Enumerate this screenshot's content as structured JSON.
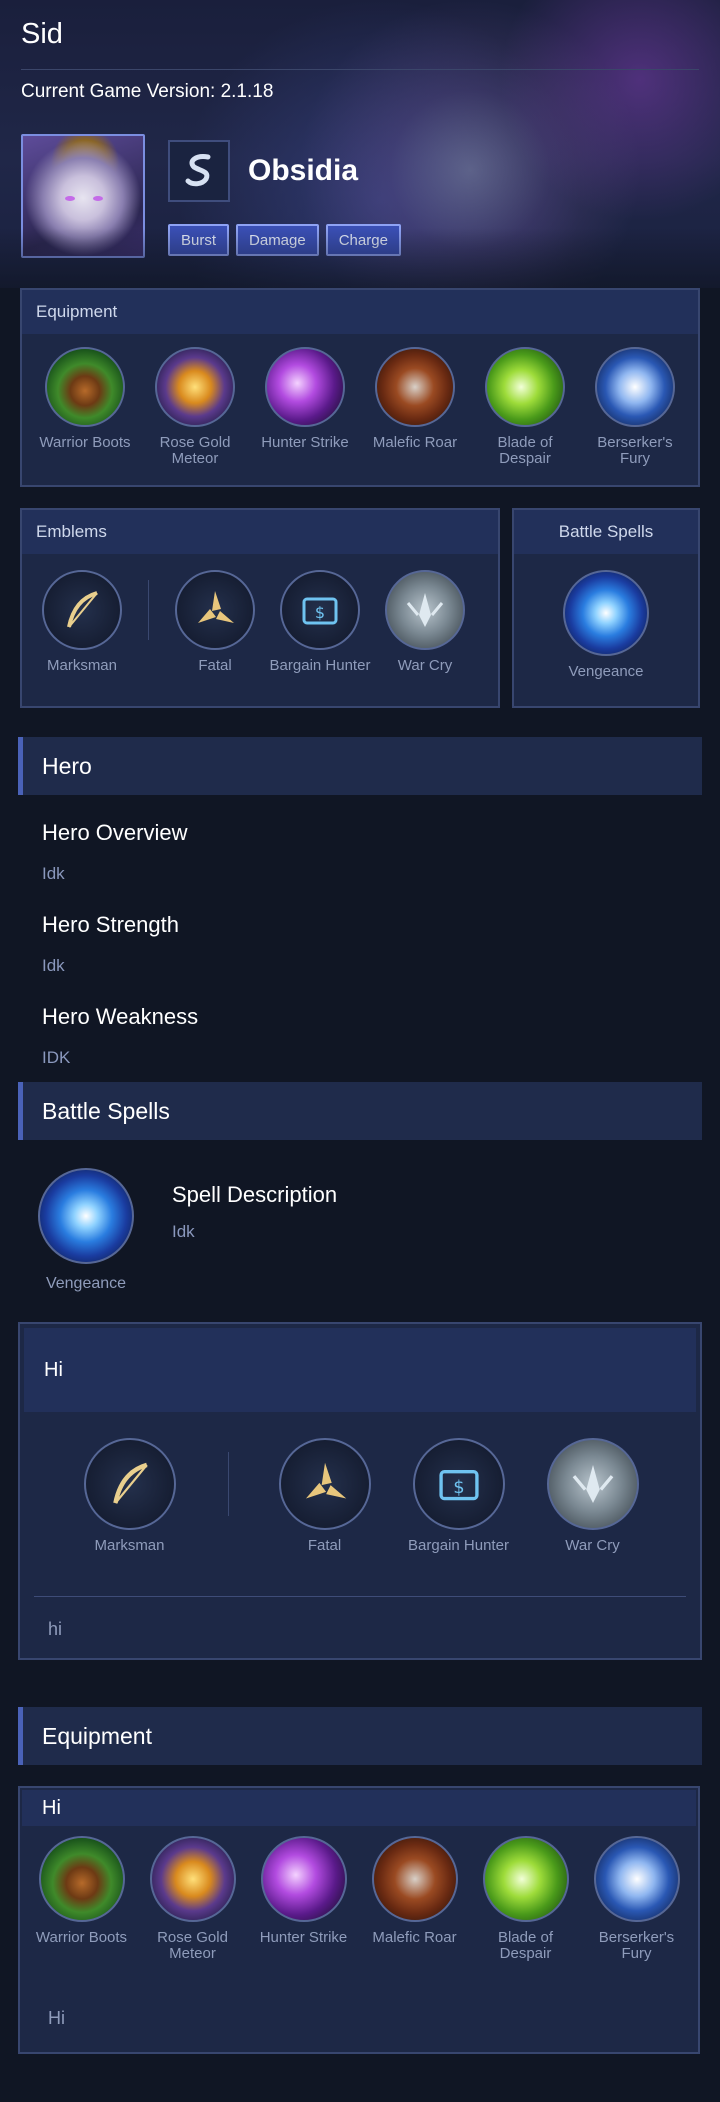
{
  "header": {
    "user_title": "Sid",
    "version_text": "Current Game Version: 2.1.18"
  },
  "hero": {
    "name": "Obsidia",
    "role_icon": "marksman-role-icon",
    "tags": [
      "Burst",
      "Damage",
      "Charge"
    ]
  },
  "equipment_panel": {
    "title": "Equipment",
    "items": [
      {
        "label": "Warrior Boots",
        "icon": "warrior-boots-icon"
      },
      {
        "label": "Rose Gold Meteor",
        "icon": "rose-gold-meteor-icon"
      },
      {
        "label": "Hunter Strike",
        "icon": "hunter-strike-icon"
      },
      {
        "label": "Malefic Roar",
        "icon": "malefic-roar-icon"
      },
      {
        "label": "Blade of Despair",
        "icon": "blade-of-despair-icon"
      },
      {
        "label": "Berserker's Fury",
        "icon": "berserkers-fury-icon"
      }
    ]
  },
  "emblems_panel": {
    "title": "Emblems",
    "main": {
      "label": "Marksman",
      "icon": "marksman-emblem-icon"
    },
    "talents": [
      {
        "label": "Fatal",
        "icon": "fatal-talent-icon"
      },
      {
        "label": "Bargain Hunter",
        "icon": "bargain-hunter-talent-icon"
      },
      {
        "label": "War Cry",
        "icon": "war-cry-talent-icon"
      }
    ]
  },
  "spells_panel": {
    "title": "Battle Spells",
    "spell": {
      "label": "Vengeance",
      "icon": "vengeance-spell-icon"
    }
  },
  "hero_section": {
    "title": "Hero",
    "overview_title": "Hero Overview",
    "overview_body": "Idk",
    "strength_title": "Hero Strength",
    "strength_body": "Idk",
    "weakness_title": "Hero Weakness",
    "weakness_body": "IDK"
  },
  "spell_section": {
    "title": "Battle Spells",
    "spell_label": "Vengeance",
    "desc_title": "Spell Description",
    "desc_body": "Idk"
  },
  "emblem_build": {
    "title": "Hi",
    "main": {
      "label": "Marksman"
    },
    "talents": [
      {
        "label": "Fatal"
      },
      {
        "label": "Bargain Hunter"
      },
      {
        "label": "War Cry"
      }
    ],
    "note": "hi"
  },
  "equipment_section": {
    "title": "Equipment",
    "build_title": "Hi",
    "items": [
      {
        "label": "Warrior Boots"
      },
      {
        "label": "Rose Gold Meteor"
      },
      {
        "label": "Hunter Strike"
      },
      {
        "label": "Malefic Roar"
      },
      {
        "label": "Blade of Despair"
      },
      {
        "label": "Berserker's Fury"
      }
    ],
    "note": "Hi"
  },
  "colors": {
    "background": "#101624",
    "panel": "#1d2846",
    "panel_header": "#22305a",
    "tag_fill": "#3a4fb4",
    "section_accent": "#4a62b8",
    "muted_text": "#8f9cbb"
  }
}
